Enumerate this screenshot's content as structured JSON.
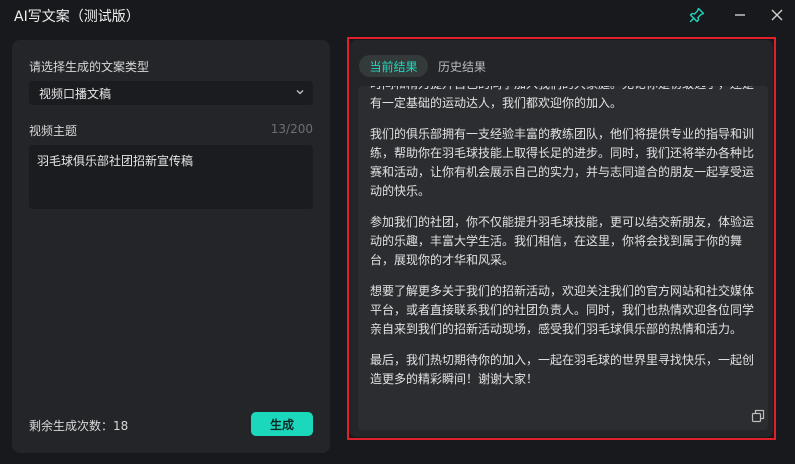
{
  "app": {
    "title": "AI写文案（测试版）"
  },
  "window_controls": {
    "pin": "pin-icon",
    "minimize": "minimize-icon",
    "close": "close-icon"
  },
  "form": {
    "type_label": "请选择生成的文案类型",
    "type_value": "视频口播文稿",
    "topic_label": "视频主题",
    "topic_counter": "13/200",
    "topic_value": "羽毛球俱乐部社团招新宣传稿",
    "remaining_label": "剩余生成次数：18",
    "generate_label": "生成"
  },
  "result": {
    "tabs": [
      {
        "label": "当前结果",
        "active": true
      },
      {
        "label": "历史结果",
        "active": false
      }
    ],
    "paragraphs": [
      "时间和精力提升自己的同学加入我们的大家庭。无论你是初级选手，还是有一定基础的运动达人，我们都欢迎你的加入。",
      "我们的俱乐部拥有一支经验丰富的教练团队，他们将提供专业的指导和训练，帮助你在羽毛球技能上取得长足的进步。同时，我们还将举办各种比赛和活动，让你有机会展示自己的实力，并与志同道合的朋友一起享受运动的快乐。",
      "参加我们的社团，你不仅能提升羽毛球技能，更可以结交新朋友，体验运动的乐趣，丰富大学生活。我们相信，在这里，你将会找到属于你的舞台，展现你的才华和风采。",
      "想要了解更多关于我们的招新活动，欢迎关注我们的官方网站和社交媒体平台，或者直接联系我们的社团负责人。同时，我们也热情欢迎各位同学亲自来到我们的招新活动现场，感受我们羽毛球俱乐部的热情和活力。",
      "最后，我们热切期待你的加入，一起在羽毛球的世界里寻找快乐，一起创造更多的精彩瞬间！谢谢大家！"
    ]
  },
  "colors": {
    "accent": "#1bd8bd",
    "highlight_border": "#e0202a",
    "background": "#18191d",
    "panel": "#242529"
  }
}
